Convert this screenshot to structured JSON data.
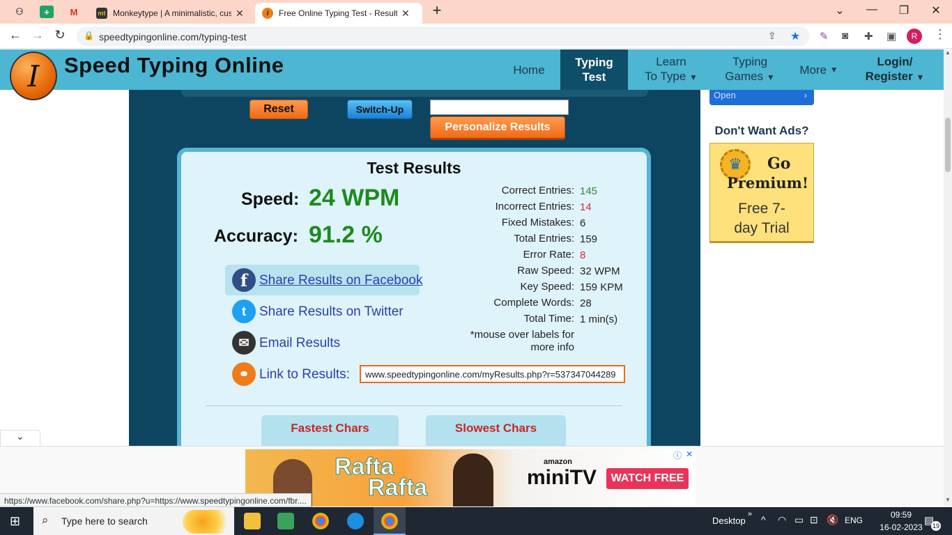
{
  "browser": {
    "tabs": [
      {
        "title": "Monkeytype | A minimalistic, cus",
        "favicon": "mt"
      },
      {
        "title": "Free Online Typing Test - Results",
        "favicon": "I"
      }
    ],
    "url": "speedtypingonline.com/typing-test",
    "profile_initial": "R"
  },
  "site": {
    "name": "Speed Typing Online",
    "logo_letter": "I",
    "nav": {
      "home": "Home",
      "typing_test": [
        "Typing",
        "Test"
      ],
      "learn": [
        "Learn",
        "To Type"
      ],
      "games": [
        "Typing",
        "Games"
      ],
      "more": "More",
      "login": [
        "Login/",
        "Register"
      ]
    }
  },
  "controls": {
    "reset": "Reset",
    "switch_up": "Switch-Up",
    "personalize": "Personalize Results",
    "name_value": ""
  },
  "results": {
    "title": "Test Results",
    "speed_label": "Speed:",
    "speed_value": "24 WPM",
    "accuracy_label": "Accuracy:",
    "accuracy_value": "91.2 %",
    "stats": [
      {
        "label": "Correct Entries:",
        "value": "145",
        "color": "#2e8b2e"
      },
      {
        "label": "Incorrect Entries:",
        "value": "14",
        "color": "#d32f2f"
      },
      {
        "label": "Fixed Mistakes:",
        "value": "6",
        "color": "#222222"
      },
      {
        "label": "Total Entries:",
        "value": "159",
        "color": "#222222"
      },
      {
        "label": "Error Rate:",
        "value": "8",
        "color": "#d32f2f"
      },
      {
        "label": "Raw Speed:",
        "value": "32 WPM",
        "color": "#222222"
      },
      {
        "label": "Key Speed:",
        "value": "159 KPM",
        "color": "#222222"
      },
      {
        "label": "Complete Words:",
        "value": "28",
        "color": "#222222"
      },
      {
        "label": "Total Time:",
        "value": "1 min(s)",
        "color": "#222222"
      }
    ],
    "mouse_note_1": "*mouse over labels for",
    "mouse_note_2": "more info",
    "share_facebook": "Share Results on Facebook",
    "share_twitter": "Share Results on Twitter",
    "email": "Email Results",
    "link_label": "Link to Results:",
    "link_value": "www.speedtypingonline.com/myResults.php?r=537347044289",
    "fastest": "Fastest Chars",
    "slowest": "Slowest Chars"
  },
  "sidebar": {
    "open": "Open",
    "ads_title": "Don't Want Ads?",
    "go": "Go",
    "premium": "Premium!",
    "trial_1": "Free 7-",
    "trial_2": "day Trial"
  },
  "ad": {
    "line1": "Rafta",
    "line2": "Rafta",
    "brand_top": "amazon",
    "brand": "miniTV",
    "cta": "WATCH FREE"
  },
  "status_url": "https://www.facebook.com/share.php?u=https://www.speedtypingonline.com/fbr....",
  "taskbar": {
    "search": "Type here to search",
    "desktop": "Desktop",
    "lang": "ENG",
    "time": "09:59",
    "date": "16-02-2023",
    "notif": "19"
  }
}
